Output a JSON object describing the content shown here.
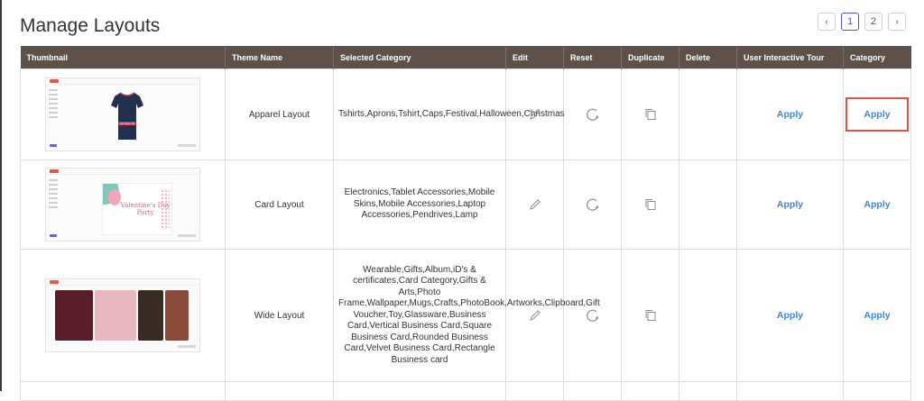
{
  "page": {
    "title": "Manage Layouts"
  },
  "pagination": {
    "prev": "‹",
    "pages": [
      "1",
      "2"
    ],
    "current": "1",
    "next": "›"
  },
  "table": {
    "headers": [
      "Thumbnail",
      "Theme Name",
      "Selected Category",
      "Edit",
      "Reset",
      "Duplicate",
      "Delete",
      "User Interactive Tour",
      "Category"
    ],
    "rows": [
      {
        "thumbnail": "apparel",
        "thumbnail_text": "SPONSOR",
        "theme_name": "Apparel Layout",
        "selected_category": "Tshirts,Aprons,Tshirt,Caps,Festival,Halloween,Christmas",
        "tour": "Apply",
        "category": "Apply"
      },
      {
        "thumbnail": "card",
        "thumbnail_text": "Valentine's Day Party",
        "theme_name": "Card Layout",
        "selected_category": "Electronics,Tablet Accessories,Mobile Skins,Mobile Accessories,Laptop Accessories,Pendrives,Lamp",
        "tour": "Apply",
        "category": "Apply"
      },
      {
        "thumbnail": "wide",
        "thumbnail_text": "",
        "theme_name": "Wide Layout",
        "selected_category": "Wearable,Gifts,Album,iD's & certificates,Card Category,Gifts & Arts,Photo Frame,Wallpaper,Mugs,Crafts,PhotoBook,Artworks,Clipboard,Gift Voucher,Toy,Glassware,Business Card,Vertical Business Card,Square Business Card,Rounded Business Card,Velvet Business Card,Rectangle Business card",
        "tour": "Apply",
        "category": "Apply"
      }
    ]
  },
  "icons": {
    "edit": "pencil-icon",
    "reset": "refresh-icon",
    "duplicate": "copy-icon"
  },
  "colors": {
    "header_bg": "#5e5149",
    "link": "#3b87d8",
    "highlight": "#d9534f",
    "pager_active": "#4b55c4"
  }
}
